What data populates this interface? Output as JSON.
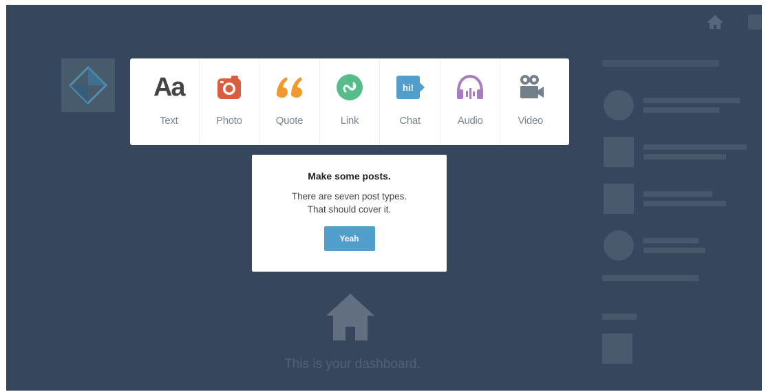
{
  "post_types": [
    {
      "label": "Text",
      "icon": "text-aa-icon",
      "color": "#444444"
    },
    {
      "label": "Photo",
      "icon": "camera-icon",
      "color": "#d95e40"
    },
    {
      "label": "Quote",
      "icon": "quote-icon",
      "color": "#f2992e"
    },
    {
      "label": "Link",
      "icon": "link-icon",
      "color": "#56bc8a"
    },
    {
      "label": "Chat",
      "icon": "chat-icon",
      "color": "#529ecc"
    },
    {
      "label": "Audio",
      "icon": "headphones-icon",
      "color": "#a77dc2"
    },
    {
      "label": "Video",
      "icon": "video-camera-icon",
      "color": "#748089"
    }
  ],
  "text_icon_glyph": "Aa",
  "chat_icon_glyph": "hi!",
  "tooltip": {
    "title": "Make some posts.",
    "line1": "There are seven post types.",
    "line2": "That should cover it.",
    "button": "Yeah"
  },
  "dashboard": {
    "caption": "This is your dashboard."
  },
  "colors": {
    "background": "#36465d",
    "button": "#529ecc"
  }
}
